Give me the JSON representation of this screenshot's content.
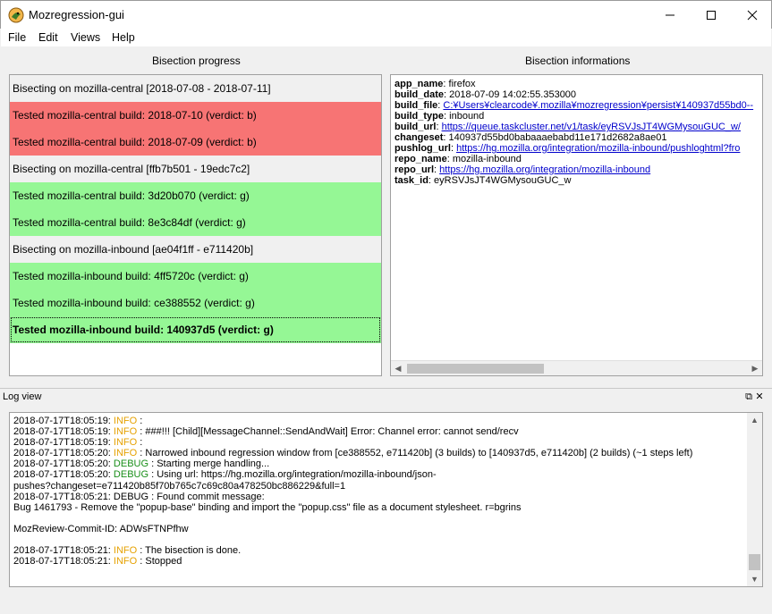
{
  "window": {
    "title": "Mozregression-gui",
    "icon": "mozregression-lizard-icon"
  },
  "menu": {
    "items": [
      "File",
      "Edit",
      "Views",
      "Help"
    ]
  },
  "bisection_progress": {
    "title": "Bisection progress",
    "rows": [
      {
        "text": "Bisecting on mozilla-central [2018-07-08 - 2018-07-11]",
        "status": "info"
      },
      {
        "text": "Tested mozilla-central build: 2018-07-10 (verdict: b)",
        "status": "bad"
      },
      {
        "text": "Tested mozilla-central build: 2018-07-09 (verdict: b)",
        "status": "bad"
      },
      {
        "text": "Bisecting on mozilla-central [ffb7b501 - 19edc7c2]",
        "status": "info"
      },
      {
        "text": "Tested mozilla-central build: 3d20b070 (verdict: g)",
        "status": "good"
      },
      {
        "text": "Tested mozilla-central build: 8e3c84df (verdict: g)",
        "status": "good"
      },
      {
        "text": "Bisecting on mozilla-inbound [ae04f1ff - e711420b]",
        "status": "info"
      },
      {
        "text": "Tested mozilla-inbound build: 4ff5720c (verdict: g)",
        "status": "good"
      },
      {
        "text": "Tested mozilla-inbound build: ce388552 (verdict: g)",
        "status": "good"
      },
      {
        "text": "Tested mozilla-inbound build: 140937d5 (verdict: g)",
        "status": "good"
      }
    ],
    "colors": {
      "bad": "#f77474",
      "good": "#95f795",
      "info": "#f0f0f0"
    }
  },
  "bisection_informations": {
    "title": "Bisection informations",
    "fields": {
      "app_name": {
        "key": "app_name",
        "value": "firefox"
      },
      "build_date": {
        "key": "build_date",
        "value": "2018-07-09 14:02:55.353000"
      },
      "build_file": {
        "key": "build_file",
        "value": "C:¥Users¥clearcode¥.mozilla¥mozregression¥persist¥140937d55bd0--"
      },
      "build_type": {
        "key": "build_type",
        "value": "inbound"
      },
      "build_url": {
        "key": "build_url",
        "value": "https://queue.taskcluster.net/v1/task/eyRSVJsJT4WGMysouGUC_w/"
      },
      "changeset": {
        "key": "changeset",
        "value": "140937d55bd0babaaaebabd11e171d2682a8ae01"
      },
      "pushlog_url": {
        "key": "pushlog_url",
        "value": "https://hg.mozilla.org/integration/mozilla-inbound/pushloghtml?fro"
      },
      "repo_name": {
        "key": "repo_name",
        "value": "mozilla-inbound"
      },
      "repo_url": {
        "key": "repo_url",
        "value": "https://hg.mozilla.org/integration/mozilla-inbound"
      },
      "task_id": {
        "key": "task_id",
        "value": "eyRSVJsJT4WGMysouGUC_w"
      }
    }
  },
  "log_view": {
    "title": "Log view",
    "lines": [
      {
        "ts": "2018-07-17T18:05:19:",
        "level": "INFO",
        "msg": ":"
      },
      {
        "ts": "2018-07-17T18:05:19:",
        "level": "INFO",
        "msg": ": ###!!! [Child][MessageChannel::SendAndWait] Error: Channel error: cannot send/recv"
      },
      {
        "ts": "2018-07-17T18:05:19:",
        "level": "INFO",
        "msg": ":"
      },
      {
        "ts": "2018-07-17T18:05:20:",
        "level": "INFO",
        "msg": ": Narrowed inbound regression window from [ce388552, e711420b] (3 builds) to [140937d5, e711420b] (2 builds) (~1 steps left)"
      },
      {
        "ts": "2018-07-17T18:05:20:",
        "level": "DEBUG",
        "msg": ": Starting merge handling..."
      },
      {
        "ts": "2018-07-17T18:05:20:",
        "level": "DEBUG",
        "msg": ": Using url: https://hg.mozilla.org/integration/mozilla-inbound/json-"
      },
      {
        "ts": "",
        "level": "",
        "msg": "pushes?changeset=e711420b85f70b765c7c69c80a478250bc886229&full=1"
      },
      {
        "ts": "2018-07-17T18:05:21:",
        "level": "",
        "msg": "DEBUG : Found commit message:"
      },
      {
        "ts": "",
        "level": "",
        "msg": "Bug 1461793 - Remove the \"popup-base\" binding and import the \"popup.css\" file as a document stylesheet. r=bgrins"
      },
      {
        "ts": "",
        "level": "",
        "msg": ""
      },
      {
        "ts": "",
        "level": "",
        "msg": "MozReview-Commit-ID: ADWsFTNPfhw"
      },
      {
        "ts": "",
        "level": "",
        "msg": ""
      },
      {
        "ts": "2018-07-17T18:05:21:",
        "level": "INFO",
        "msg": ": The bisection is done."
      },
      {
        "ts": "2018-07-17T18:05:21:",
        "level": "INFO",
        "msg": ": Stopped"
      }
    ],
    "level_colors": {
      "INFO": "#e6a100",
      "DEBUG": "#1a8f1a"
    }
  }
}
